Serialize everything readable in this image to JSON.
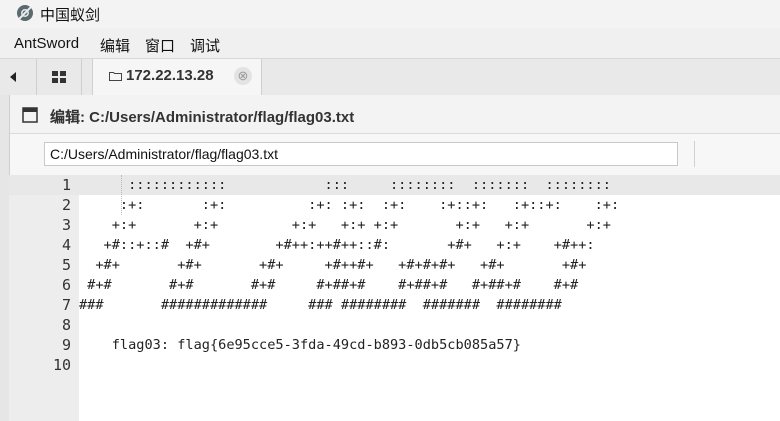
{
  "app": {
    "title": "中国蚁剑"
  },
  "menu": [
    "AntSword",
    "编辑",
    "窗口",
    "调试"
  ],
  "tabs": {
    "active_label": "172.22.13.28",
    "close_glyph": "⊗"
  },
  "panel": {
    "title": "编辑: C:/Users/Administrator/flag/flag03.txt",
    "path_value": "C:/Users/Administrator/flag/flag03.txt"
  },
  "editor": {
    "line_numbers": [
      "1",
      "2",
      "3",
      "4",
      "5",
      "6",
      "7",
      "8",
      "9",
      "10"
    ],
    "lines": [
      "      ::::::::::::            :::     ::::::::  :::::::  ::::::::",
      "     :+:       :+:          :+: :+:  :+:    :+::+:   :+::+:    :+:",
      "    +:+       +:+         +:+   +:+ +:+       +:+   +:+       +:+",
      "   +#::+::#  +#+        +#++:++#++::#:       +#+   +:+    +#++:",
      "  +#+       +#+       +#+     +#++#+   +#+#+#+   +#+       +#+",
      " #+#       #+#       #+#     #+##+#    #+##+#   #+##+#    #+#",
      "###       #############     ### ########  #######  ########",
      "",
      "    flag03: flag{6e95cce5-3fda-49cd-b893-0db5cb085a57}",
      ""
    ]
  },
  "colors": {
    "accent": "#333333",
    "gutter": "#ededed",
    "highlight": "#e8e8e8"
  }
}
